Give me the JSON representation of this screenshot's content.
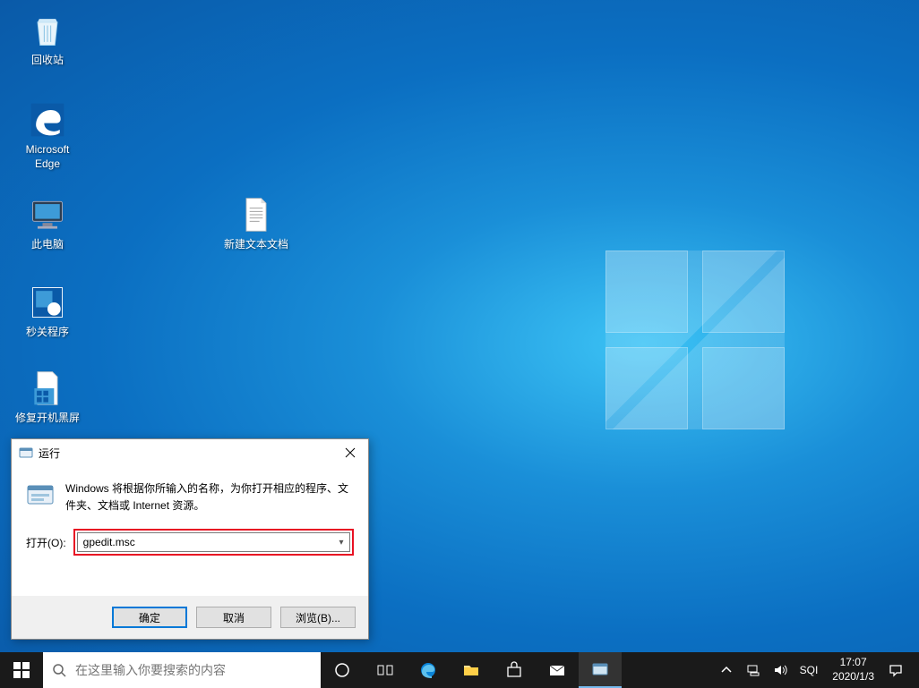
{
  "desktop": {
    "icons": [
      {
        "id": "recycle-bin",
        "label": "回收站"
      },
      {
        "id": "edge",
        "label": "Microsoft\nEdge"
      },
      {
        "id": "this-pc",
        "label": "此电脑"
      },
      {
        "id": "shutdown-app",
        "label": "秒关程序"
      },
      {
        "id": "fix-boot",
        "label": "修复开机黑屏"
      },
      {
        "id": "text-doc",
        "label": "新建文本文档"
      }
    ]
  },
  "run_dialog": {
    "title": "运行",
    "description": "Windows 将根据你所输入的名称，为你打开相应的程序、文件夹、文档或 Internet 资源。",
    "open_label": "打开(O):",
    "value": "gpedit.msc",
    "buttons": {
      "ok": "确定",
      "cancel": "取消",
      "browse": "浏览(B)..."
    }
  },
  "taskbar": {
    "search_placeholder": "在这里输入你要搜索的内容",
    "ime": "SQI",
    "time": "17:07",
    "date": "2020/1/3"
  }
}
